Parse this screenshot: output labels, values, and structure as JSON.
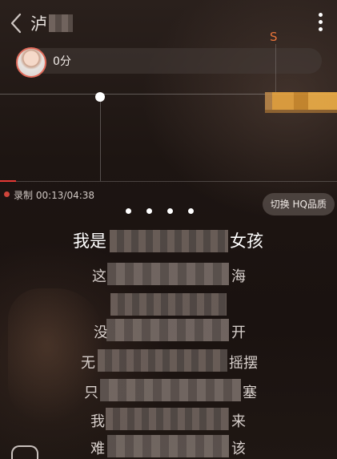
{
  "header": {
    "title_visible_char": "泸",
    "back_icon": "chevron-left-icon",
    "more_icon": "more-vertical-icon"
  },
  "score": {
    "label": "0分"
  },
  "pitch": {
    "marker": "S"
  },
  "recording": {
    "label": "录制 00:13/04:38",
    "elapsed": "00:13",
    "total": "04:38",
    "progress": 0.047
  },
  "quality_button": {
    "label": "切换 HQ品质"
  },
  "pager": {
    "count": 4
  },
  "lyrics": [
    {
      "left": "我是",
      "right": "女孩",
      "current": true
    },
    {
      "left": "这",
      "right": "海",
      "current": false
    },
    {
      "left": "",
      "right": "",
      "current": false
    },
    {
      "left": "没",
      "right": "开",
      "current": false
    },
    {
      "left": "无",
      "right": "摇摆",
      "current": false
    },
    {
      "left": "只",
      "right": "塞",
      "current": false
    },
    {
      "left": "我",
      "right": "来",
      "current": false
    },
    {
      "left": "难",
      "right": "该",
      "current": false
    }
  ],
  "colors": {
    "accent": "#e8743a",
    "record": "#d0453b",
    "progress": "#e53935"
  }
}
